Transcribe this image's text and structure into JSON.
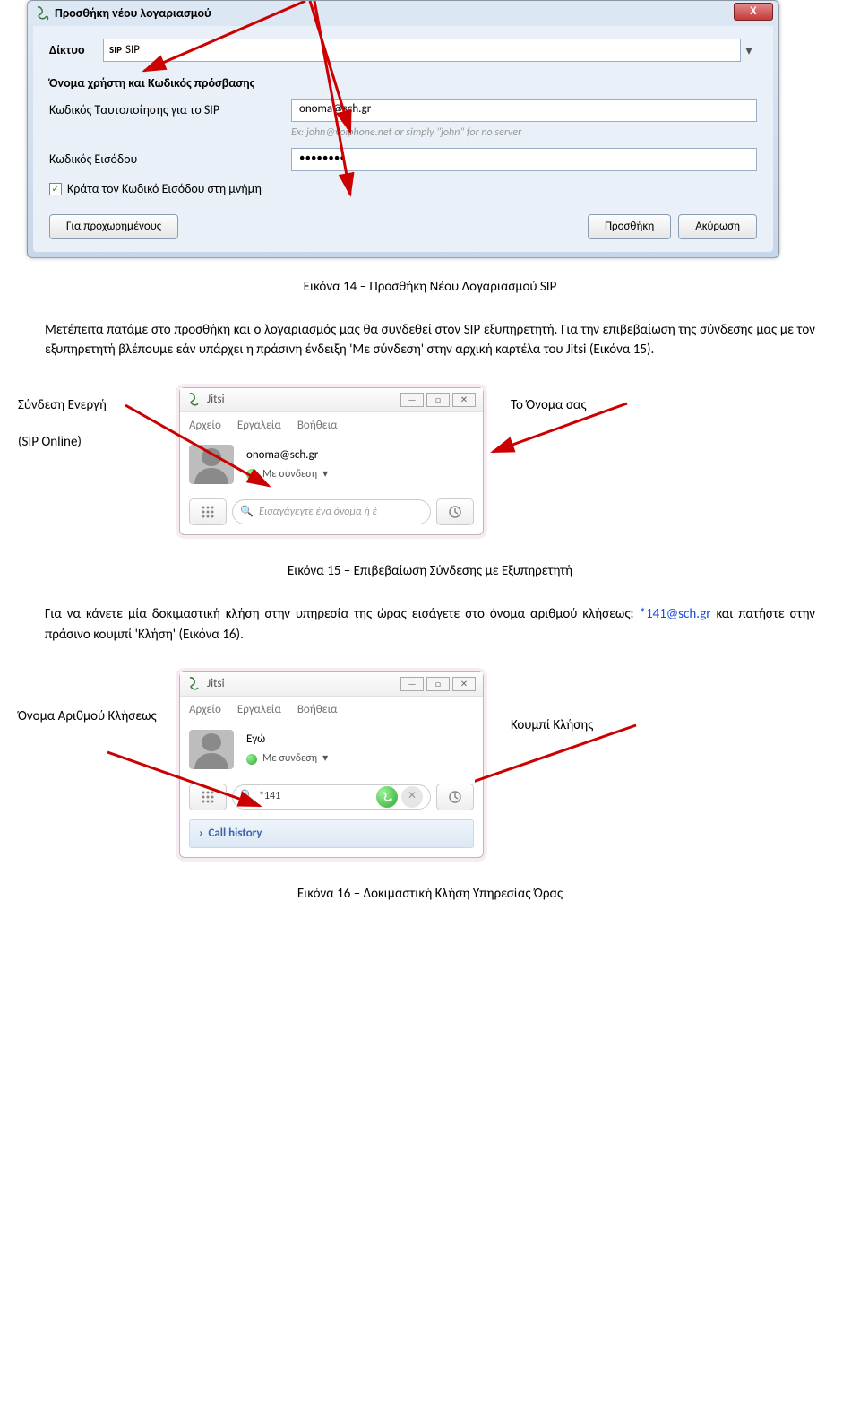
{
  "dialog": {
    "title": "Προσθήκη νέου λογαριασμού",
    "close": "X",
    "net_label": "Δίκτυο",
    "net_sip_chip": "SIP",
    "net_value": "SIP",
    "section_header": "Όνομα χρήστη και Κωδικός πρόσβασης",
    "id_label": "Κωδικός Ταυτοποίησης για το SIP",
    "id_value": "onoma@sch.gr",
    "id_hint": "Ex: john@voiphone.net or simply \"john\" for no server",
    "pass_label": "Κωδικός Εισόδου",
    "pass_value": "••••••••",
    "remember_label": "Κράτα τον Κωδικό Εισόδου στη μνήμη",
    "btn_advanced": "Για προχωρημένους",
    "btn_add": "Προσθήκη",
    "btn_cancel": "Ακύρωση"
  },
  "caption14": "Εικόνα 14 – Προσθήκη Νέου Λογαριασμού SIP",
  "para1": "Μετέπειτα πατάμε στο προσθήκη και ο λογαριασμός μας θα συνδεθεί στον SIP εξυπηρετητή. Για την επιβεβαίωση της σύνδεσής μας με τον εξυπηρετητή βλέπουμε εάν υπάρχει η πράσινη ένδειξη 'Με σύνδεση' στην αρχική καρτέλα του Jitsi (Εικόνα 15).",
  "annot1": {
    "left1": "Σύνδεση Ενεργή",
    "left2": "(SIP Online)",
    "right": "Το Όνομα σας"
  },
  "jitsi1": {
    "title": "Jitsi",
    "menu_file": "Αρχείο",
    "menu_tools": "Εργαλεία",
    "menu_help": "Βοήθεια",
    "profile_name": "onoma@sch.gr",
    "status": "Με σύνδεση",
    "search_placeholder": "Εισαγάγεγτε ένα όνομα ή έ"
  },
  "caption15": "Εικόνα 15 – Επιβεβαίωση Σύνδεσης με Εξυπηρετητή",
  "para2_pre": "Για να κάνετε μία δοκιμαστική κλήση στην υπηρεσία της ώρας εισάγετε στο όνομα αριθμού κλήσεως: ",
  "para2_link": "*141@sch.gr",
  "para2_post": " και πατήστε στην πράσινο κουμπί 'Κλήση' (Εικόνα 16).",
  "annot2": {
    "left": "Όνομα Αριθμού Κλήσεως",
    "right": "Κουμπί Κλήσης"
  },
  "jitsi2": {
    "title": "Jitsi",
    "menu_file": "Αρχείο",
    "menu_tools": "Εργαλεία",
    "menu_help": "Βοήθεια",
    "profile_name": "Εγώ",
    "status": "Με σύνδεση",
    "search_value": "*141",
    "call_history": "Call history"
  },
  "caption16": "Εικόνα 16 – Δοκιμαστική Κλήση Υπηρεσίας Ώρας"
}
